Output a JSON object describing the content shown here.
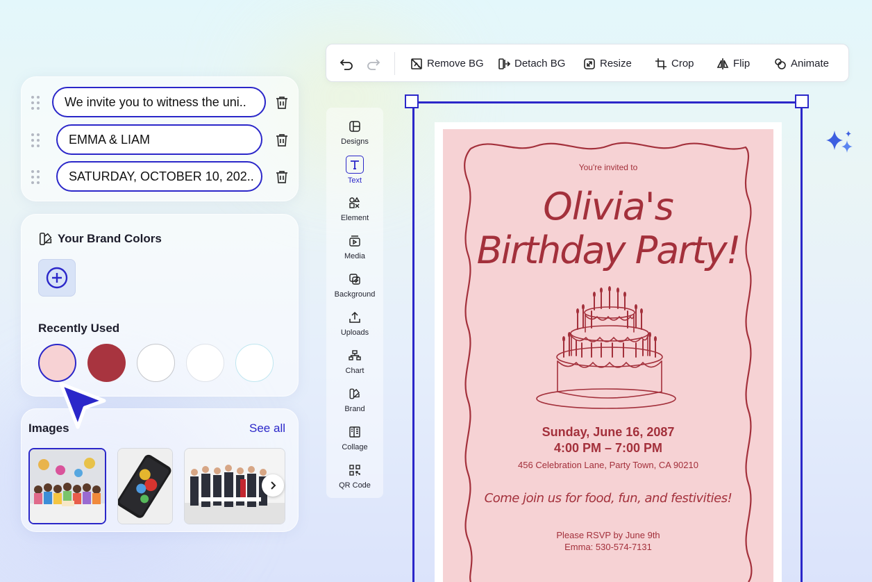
{
  "text_fields": [
    "We invite you to witness the uni..",
    "EMMA & LIAM",
    "SATURDAY, OCTOBER 10, 202.."
  ],
  "brand": {
    "title": "Your Brand Colors",
    "recently_used_label": "Recently Used",
    "swatches": [
      "#f7d2d4",
      "#a8343f",
      "#ffffff",
      "#ffffff",
      "#ffffff"
    ]
  },
  "images": {
    "title": "Images",
    "see_all": "See all"
  },
  "toolbar": {
    "remove_bg": "Remove BG",
    "detach_bg": "Detach BG",
    "resize": "Resize",
    "crop": "Crop",
    "flip": "Flip",
    "animate": "Animate"
  },
  "menu": [
    {
      "label": "Designs",
      "icon": "layout-icon"
    },
    {
      "label": "Text",
      "icon": "text-icon",
      "active": true
    },
    {
      "label": "Element",
      "icon": "shapes-icon"
    },
    {
      "label": "Media",
      "icon": "media-icon"
    },
    {
      "label": "Background",
      "icon": "background-icon"
    },
    {
      "label": "Uploads",
      "icon": "upload-icon"
    },
    {
      "label": "Chart",
      "icon": "chart-icon"
    },
    {
      "label": "Brand",
      "icon": "brand-icon"
    },
    {
      "label": "Collage",
      "icon": "collage-icon"
    },
    {
      "label": "QR Code",
      "icon": "qr-code-icon"
    }
  ],
  "invitation": {
    "intro": "You're invited to",
    "name": "Olivia's",
    "event": "Birthday  Party!",
    "date": "Sunday, June 16, 2087",
    "time": "4:00 PM – 7:00 PM",
    "address": "456 Celebration Lane, Party Town, CA 90210",
    "tagline": "Come join us for food, fun, and festivities!",
    "rsvp": "Please RSVP by June 9th",
    "contact": "Emma: 530-574-7131"
  },
  "colors": {
    "accent": "#2b27c9",
    "card": "#f6d2d4",
    "ink": "#a3303b"
  }
}
